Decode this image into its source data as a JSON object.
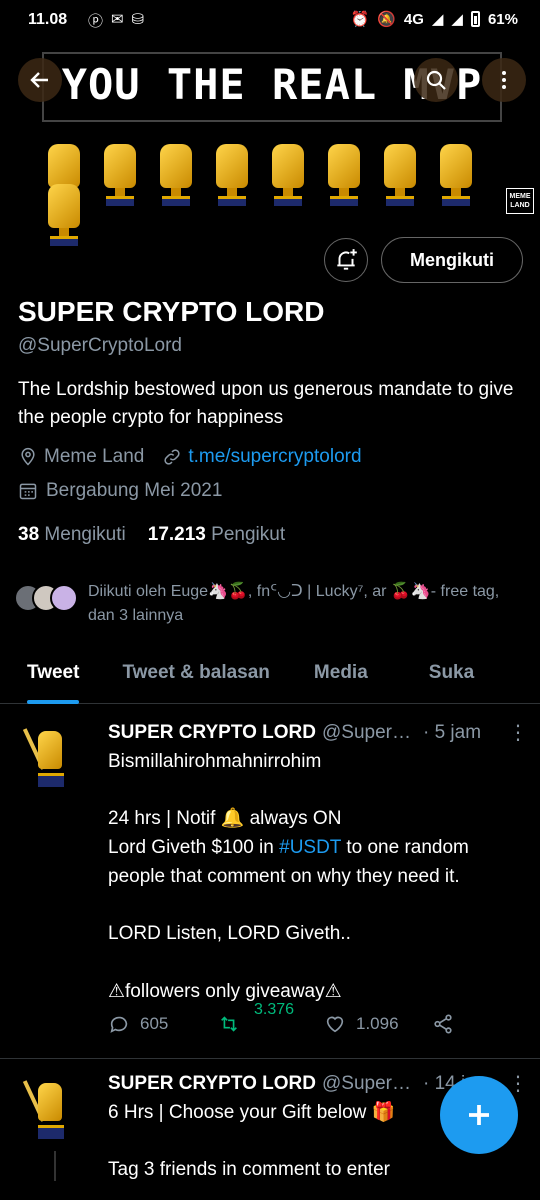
{
  "status": {
    "time": "11.08",
    "network": "4G",
    "battery": "61%"
  },
  "banner": {
    "title": "YOU THE REAL MVP",
    "badge": "MEME LAND"
  },
  "actions": {
    "follow_label": "Mengikuti"
  },
  "profile": {
    "name": "SUPER CRYPTO LORD",
    "handle": "@SuperCryptoLord",
    "bio": "The Lordship bestowed upon us generous mandate to give the people crypto for happiness",
    "location": "Meme Land",
    "link": "t.me/supercryptolord",
    "joined": "Bergabung Mei 2021",
    "following_count": "38",
    "following_label": "Mengikuti",
    "followers_count": "17.213",
    "followers_label": "Pengikut",
    "followed_by": "Diikuti oleh Euge🦄🍒, fnᑦ◡ᑐ | Lucky⁷, ar 🍒🦄- free tag, dan 3 lainnya"
  },
  "tabs": [
    "Tweet",
    "Tweet & balasan",
    "Media",
    "Suka"
  ],
  "tweets": [
    {
      "name": "SUPER CRYPTO LORD",
      "handle": "@SuperCryptoLord",
      "time": "· 5 jam",
      "line1": "Bismillahirohmahnirrohim",
      "line2": "24 hrs | Notif 🔔 always ON",
      "line3a": "Lord Giveth $100 in ",
      "hashtag": "#USDT",
      "line3b": " to one random people that comment on why they need it.",
      "line4": "LORD Listen, LORD Giveth..",
      "line5": "⚠followers only giveaway⚠",
      "replies": "605",
      "retweets": "3.376",
      "likes": "1.096"
    },
    {
      "name": "SUPER CRYPTO LORD",
      "handle": "@SuperCryptoLord",
      "time": "· 14 j",
      "line1": "6 Hrs | Choose your Gift below 🎁",
      "line2": "Tag 3 friends in comment to enter"
    }
  ],
  "icons": {
    "back": "arrow-left-icon",
    "search": "search-icon",
    "more": "more-vertical-icon",
    "notify": "bell-plus-icon",
    "compose": "plus-icon"
  },
  "colors": {
    "accent": "#1d9bf0",
    "retweet": "#00ba7c",
    "background": "#000000"
  }
}
